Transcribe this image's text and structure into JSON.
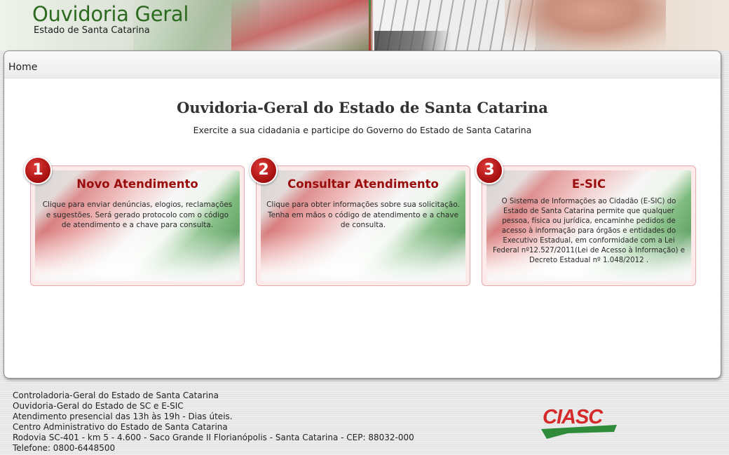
{
  "header": {
    "title": "Ouvidoria Geral",
    "subtitle": "Estado de Santa Catarina"
  },
  "nav": {
    "home": "Home"
  },
  "main": {
    "title": "Ouvidoria-Geral do Estado de Santa Catarina",
    "subtitle": "Exercite a sua cidadania e participe do Governo do Estado de Santa Catarina"
  },
  "cards": [
    {
      "number": "1",
      "title": "Novo Atendimento",
      "text": "Clique para enviar denúncias, elogios, reclamações e sugestões. Será gerado protocolo com o código de atendimento e a chave para consulta."
    },
    {
      "number": "2",
      "title": "Consultar Atendimento",
      "text": "Clique para obter informações sobre sua solicitação. Tenha em mãos o código de atendimento e a chave de consulta."
    },
    {
      "number": "3",
      "title": "E-SIC",
      "text": "O Sistema de Informações ao Cidadão (E-SIC) do Estado de Santa Catarina permite que qualquer pessoa, física ou jurídica, encaminhe pedidos de acesso à informação para órgãos e entidades do Executivo Estadual, em conformidade com a Lei Federal nº12.527/2011(Lei de Acesso à Informação) e Decreto Estadual nº 1.048/2012 ."
    }
  ],
  "footer": {
    "lines": [
      "Controladoria-Geral do Estado de Santa Catarina",
      "Ouvidoria-Geral do Estado de SC e E-SIC",
      "Atendimento presencial das 13h às 19h - Dias úteis.",
      "Centro Administrativo do Estado de Santa Catarina",
      "Rodovia SC-401 - km 5 - 4.600 - Saco Grande II Florianópolis - Santa Catarina - CEP: 88032-000",
      "Telefone: 0800-6448500"
    ],
    "logo_text": "CIASC"
  },
  "colors": {
    "title_green": "#2c6b1f",
    "card_title_red": "#9a0d0d",
    "badge_red": "#b51414",
    "logo_green": "#2e8b3a",
    "logo_red": "#d42a2a"
  }
}
